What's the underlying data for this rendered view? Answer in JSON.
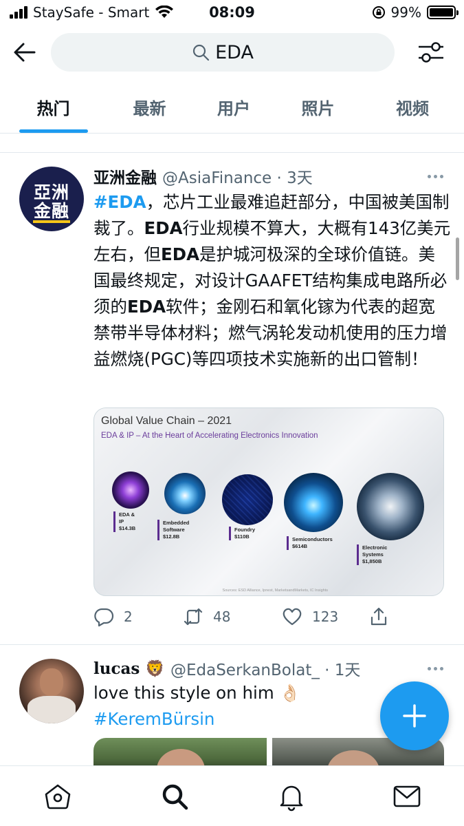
{
  "status_bar": {
    "carrier": "StaySafe - Smart",
    "time": "08:09",
    "battery_percent": "99%",
    "battery_level": 0.99
  },
  "search": {
    "query": "EDA"
  },
  "tabs": [
    {
      "label": "热门",
      "active": true
    },
    {
      "label": "最新",
      "active": false
    },
    {
      "label": "用户",
      "active": false
    },
    {
      "label": "照片",
      "active": false
    },
    {
      "label": "视频",
      "active": false
    }
  ],
  "tweets": [
    {
      "avatar_text_top": "亞洲",
      "avatar_text_bottom": "金融",
      "name": "亚洲金融",
      "handle": "@AsiaFinance · 3天",
      "text": {
        "hashtag": "#EDA",
        "p1": "，芯片工业最难追赶部分，中国被美国制裁了。",
        "b1": "EDA",
        "p2": "行业规模不算大，大概有143亿美元左右，但",
        "b2": "EDA",
        "p3": "是护城河极深的全球价值链。美国最终规定，对设计GAAFET结构集成电路所必须的",
        "b3": "EDA",
        "p4": "软件；金刚石和氧化镓为代表的超宽禁带半导体材料；燃气涡轮发动机使用的压力增益燃烧(PGC)等四项技术实施新的出口管制！"
      },
      "media": {
        "title": "Global Value Chain – 2021",
        "subtitle": "EDA & IP – At the Heart of Accelerating Electronics Innovation",
        "items": [
          {
            "name": "EDA & IP",
            "value": "$14.3B"
          },
          {
            "name": "Embedded Software",
            "value": "$12.8B"
          },
          {
            "name": "Foundry",
            "value": "$110B"
          },
          {
            "name": "Semiconductors",
            "value": "$614B"
          },
          {
            "name": "Electronic Systems",
            "value": "$1,850B"
          }
        ],
        "source": "Sources: ESD Alliance, Ipnest, MarketsandMarkets, IC Insights"
      },
      "replies": "2",
      "retweets": "48",
      "likes": "123"
    },
    {
      "name": "lucas 🦁",
      "handle": "@EdaSerkanBolat_ · 1天",
      "text_line1": "love this style on him 👌🏻",
      "hashtag": "#KeremBürsin"
    }
  ],
  "colors": {
    "accent": "#1d9bf0",
    "text_primary": "#0f1419",
    "text_secondary": "#536471",
    "avatar_bg": "#1a1f4d",
    "avatar_underline": "#f5c518"
  },
  "icons": {
    "back": "arrow-left-icon",
    "search": "search-icon",
    "filter": "filter-sliders-icon",
    "reply": "reply-icon",
    "retweet": "retweet-icon",
    "like": "heart-icon",
    "share": "share-icon",
    "compose": "plus-icon",
    "home": "home-icon",
    "explore": "search-icon",
    "notifications": "bell-icon",
    "messages": "mail-icon"
  }
}
